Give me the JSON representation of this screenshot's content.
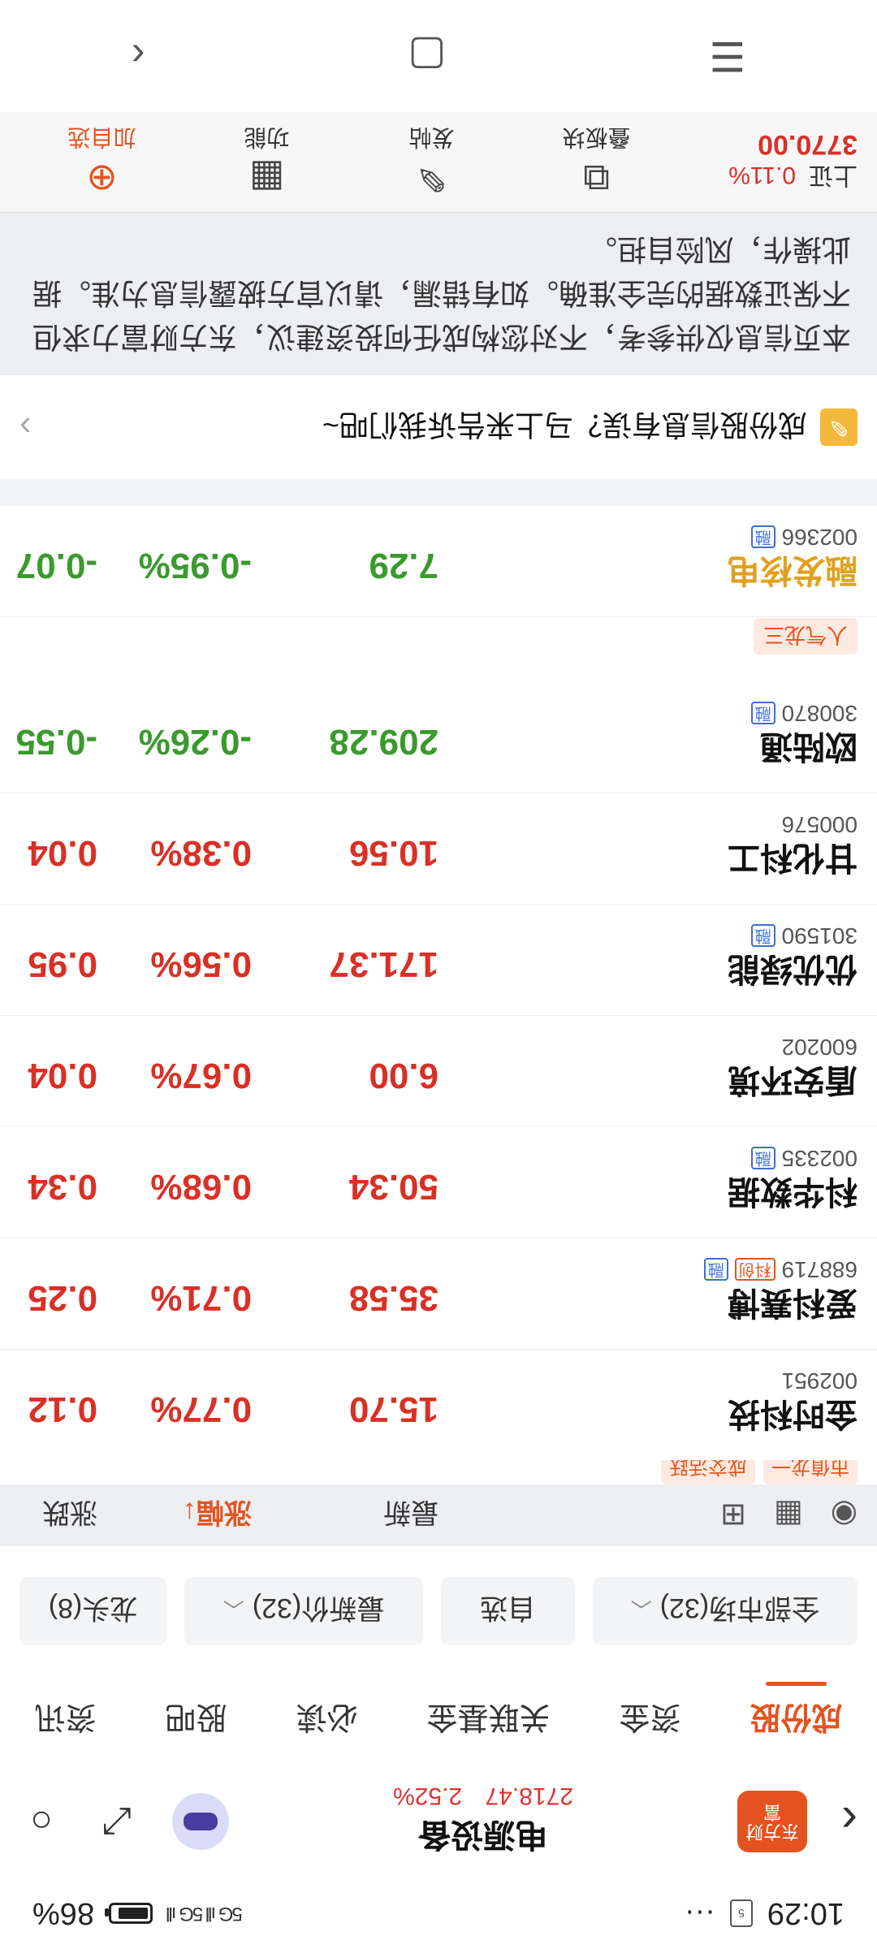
{
  "status_bar": {
    "time": "10:29",
    "sim_label": "5",
    "more": "···",
    "battery": "86",
    "battery_pct": "86%",
    "signal_text": "5G ıll 5G ıll",
    "battery_level": 0.86
  },
  "header": {
    "back_icon": "chevron-left-icon",
    "logo_text": "东方财富",
    "title": "电源设备",
    "price": "2718.47",
    "change_pct": "2.52%"
  },
  "tabs": [
    {
      "label": "成份股",
      "active": true
    },
    {
      "label": "资金"
    },
    {
      "label": "关联基金"
    },
    {
      "label": "必读"
    },
    {
      "label": "股吧"
    },
    {
      "label": "资讯"
    }
  ],
  "filters": {
    "market": "全部市场(32)",
    "self": "自选",
    "latest": "最新价(32)",
    "leader": "龙头(8)"
  },
  "columns": {
    "latest": "最新",
    "pct": "涨幅↓",
    "change": "涨跌"
  },
  "list_tags": [
    "市值龙一",
    "成交活跃"
  ],
  "rows": [
    {
      "name": "金时科技",
      "code": "002951",
      "price": "15.70",
      "pct": "0.77%",
      "chg": "0.12",
      "dir": "up",
      "badges": []
    },
    {
      "name": "爱科赛博",
      "code": "688719",
      "price": "35.58",
      "pct": "0.71%",
      "chg": "0.25",
      "dir": "up",
      "badges": [
        "科创",
        "融"
      ]
    },
    {
      "name": "科华数据",
      "code": "002335",
      "price": "50.34",
      "pct": "0.68%",
      "chg": "0.34",
      "dir": "up",
      "badges": [
        "融"
      ]
    },
    {
      "name": "盾安环境",
      "code": "600202",
      "price": "6.00",
      "pct": "0.67%",
      "chg": "0.04",
      "dir": "up",
      "badges": []
    },
    {
      "name": "优优绿能",
      "code": "301590",
      "price": "171.37",
      "pct": "0.56%",
      "chg": "0.95",
      "dir": "up",
      "badges": [
        "融"
      ]
    },
    {
      "name": "甘化科工",
      "code": "000576",
      "price": "10.56",
      "pct": "0.38%",
      "chg": "0.04",
      "dir": "up",
      "badges": []
    },
    {
      "name": "欧陆通",
      "code": "300870",
      "price": "209.28",
      "pct": "-0.26%",
      "chg": "-0.55",
      "dir": "down",
      "badges": [
        "融"
      ],
      "tag": "人气龙三"
    },
    {
      "name": "融发核电",
      "code": "002366",
      "price": "7.29",
      "pct": "-0.95%",
      "chg": "-0.07",
      "dir": "down",
      "badges": [
        "融"
      ],
      "name_color": "#e0a020"
    }
  ],
  "feedback": {
    "text": "成份股信息有误？马上来告诉我们吧~"
  },
  "disclaimer": "本页信息仅供参考，不对您构成任何投资建议，东方财富力求但不保证数据的完全准确。如有错漏，请以官方披露信息为准。据此操作，风险自担。",
  "toolbar": {
    "index_name": "上证",
    "index_pct": "0.11%",
    "index_price": "3770.00",
    "items": [
      {
        "label": "叠板块",
        "icon": "stack-board-icon"
      },
      {
        "label": "发帖",
        "icon": "edit-icon"
      },
      {
        "label": "功能",
        "icon": "grid-icon"
      },
      {
        "label": "加自选",
        "icon": "plus-circle-icon"
      }
    ]
  },
  "colors": {
    "brand": "#e4531f",
    "up": "#d93026",
    "down": "#3a9a2d"
  }
}
